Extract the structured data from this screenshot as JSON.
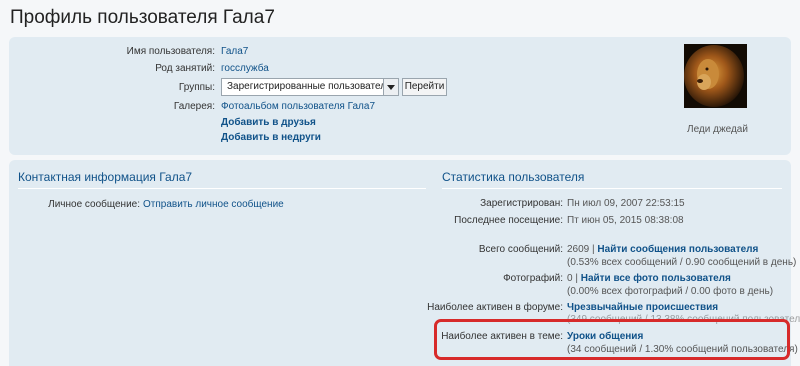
{
  "page": {
    "title": "Профиль пользователя Гала7"
  },
  "profile": {
    "username_label": "Имя пользователя:",
    "username_value": "Гала7",
    "occupation_label": "Род занятий:",
    "occupation_value": "госслужба",
    "groups_label": "Группы:",
    "groups_selected": "Зарегистрированные пользователи",
    "go_button": "Перейти",
    "gallery_label": "Галерея:",
    "gallery_link": "Фотоальбом пользователя Гала7",
    "add_friend": "Добавить в друзья",
    "add_foe": "Добавить в недруги",
    "avatar_caption": "Леди джедай"
  },
  "contact": {
    "heading": "Контактная информация Гала7",
    "pm_label": "Личное сообщение:",
    "pm_link": "Отправить личное сообщение"
  },
  "stats": {
    "heading": "Статистика пользователя",
    "registered_label": "Зарегистрирован:",
    "registered_value": "Пн июл 09, 2007 22:53:15",
    "last_visit_label": "Последнее посещение:",
    "last_visit_value": "Пт июн 05, 2015 08:38:08",
    "total_posts_label": "Всего сообщений:",
    "total_posts_value": "2609 |",
    "find_posts_link": "Найти сообщения пользователя",
    "posts_detail": "(0.53% всех сообщений / 0.90 сообщений в день)",
    "photos_label": "Фотографий:",
    "photos_value": "0 |",
    "find_photos_link": "Найти все фото пользователя",
    "photos_detail": "(0.00% всех фотографий / 0.00 фото в день)",
    "active_forum_label": "Наиболее активен в форуме:",
    "active_forum_link": "Чрезвычайные происшествия",
    "active_forum_detail": "(349 сообщений / 13.38% сообщений пользователя)",
    "active_topic_label": "Наиболее активен в теме:",
    "active_topic_link": "Уроки общения",
    "active_topic_detail": "(34 сообщений / 1.30% сообщений пользователя)"
  },
  "colors": {
    "link": "#105289",
    "panel": "#e1ebf2",
    "highlight_border": "#d72a2a"
  },
  "icons": [
    "dropdown-arrow-icon"
  ]
}
